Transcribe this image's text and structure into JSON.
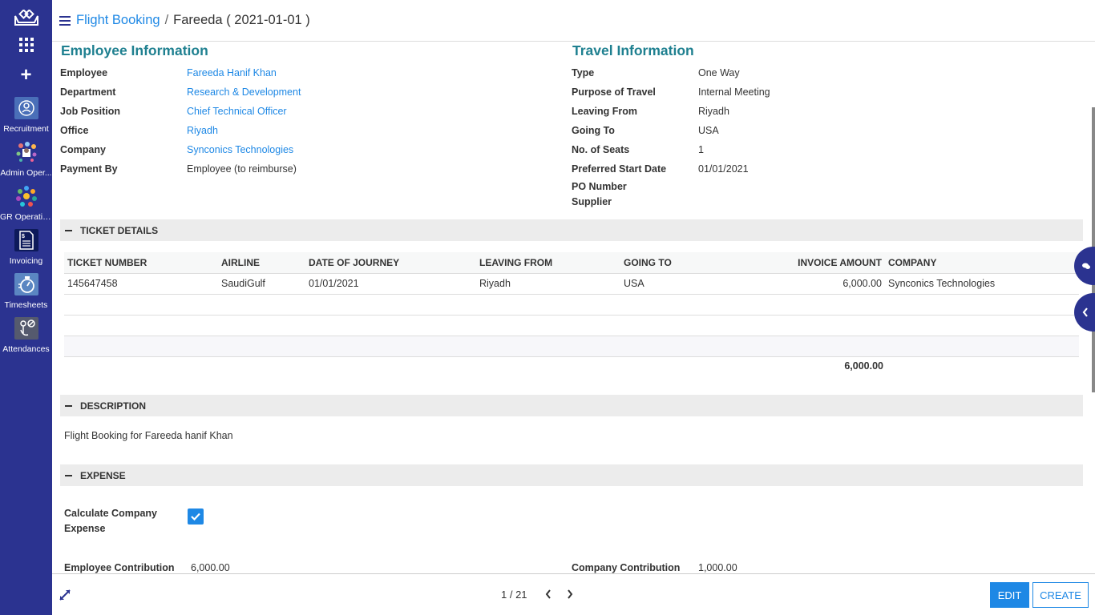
{
  "sidebar": {
    "logo": "crown-logo-icon",
    "menu_icon": "apps-grid-icon",
    "add_icon": "plus-icon",
    "apps": [
      {
        "label": "Recruitment",
        "icon": "recruitment-icon",
        "color": "#4a6fb8"
      },
      {
        "label": "Admin Oper...",
        "icon": "admin-operations-icon",
        "color": "#2b3390"
      },
      {
        "label": "GR Operatio...",
        "icon": "gr-operations-icon",
        "color": "#2b3390"
      },
      {
        "label": "Invoicing",
        "icon": "invoicing-icon",
        "color": "#0d1a5a"
      },
      {
        "label": "Timesheets",
        "icon": "timesheets-icon",
        "color": "#5b86c2"
      },
      {
        "label": "Attendances",
        "icon": "attendances-icon",
        "color": "#555a6e"
      }
    ]
  },
  "header": {
    "breadcrumb_parent": "Flight Booking",
    "breadcrumb_sep": "/",
    "breadcrumb_current": "Fareeda ( 2021-01-01 )"
  },
  "employee_info": {
    "title": "Employee Information",
    "fields": [
      {
        "label": "Employee",
        "value": "Fareeda Hanif Khan",
        "link": true
      },
      {
        "label": "Department",
        "value": "Research & Development",
        "link": true
      },
      {
        "label": "Job Position",
        "value": "Chief Technical Officer",
        "link": true
      },
      {
        "label": "Office",
        "value": "Riyadh",
        "link": true
      },
      {
        "label": "Company",
        "value": "Synconics Technologies",
        "link": true
      },
      {
        "label": "Payment By",
        "value": "Employee (to reimburse)",
        "link": false
      }
    ]
  },
  "travel_info": {
    "title": "Travel Information",
    "fields": [
      {
        "label": "Type",
        "value": "One Way"
      },
      {
        "label": "Purpose of Travel",
        "value": "Internal Meeting"
      },
      {
        "label": "Leaving From",
        "value": "Riyadh"
      },
      {
        "label": "Going To",
        "value": "USA"
      },
      {
        "label": "No. of Seats",
        "value": "1"
      },
      {
        "label": "Preferred Start Date",
        "value": "01/01/2021"
      },
      {
        "label": "PO Number",
        "value": ""
      },
      {
        "label": "Supplier",
        "value": ""
      }
    ]
  },
  "ticket_details": {
    "title": "TICKET DETAILS",
    "columns": [
      "TICKET NUMBER",
      "AIRLINE",
      "DATE OF JOURNEY",
      "LEAVING FROM",
      "GOING TO",
      "INVOICE AMOUNT",
      "COMPANY"
    ],
    "rows": [
      [
        "145647458",
        "SaudiGulf",
        "01/01/2021",
        "Riyadh",
        "USA",
        "6,000.00",
        "Synconics Technologies"
      ]
    ],
    "total": "6,000.00"
  },
  "description": {
    "title": "DESCRIPTION",
    "text": "Flight Booking for Fareeda hanif Khan"
  },
  "expense": {
    "title": "EXPENSE",
    "calc_label": "Calculate Company Expense",
    "calc_checked": true,
    "employee_contribution_label": "Employee Contribution",
    "employee_contribution_value": "6,000.00",
    "company_contribution_label": "Company Contribution",
    "company_contribution_value": "1,000.00"
  },
  "footer": {
    "pager": "1 / 21",
    "edit_label": "EDIT",
    "create_label": "CREATE"
  },
  "colors": {
    "sidebar": "#2b3390",
    "accent": "#1e88e5",
    "group_title": "#1f8090"
  }
}
